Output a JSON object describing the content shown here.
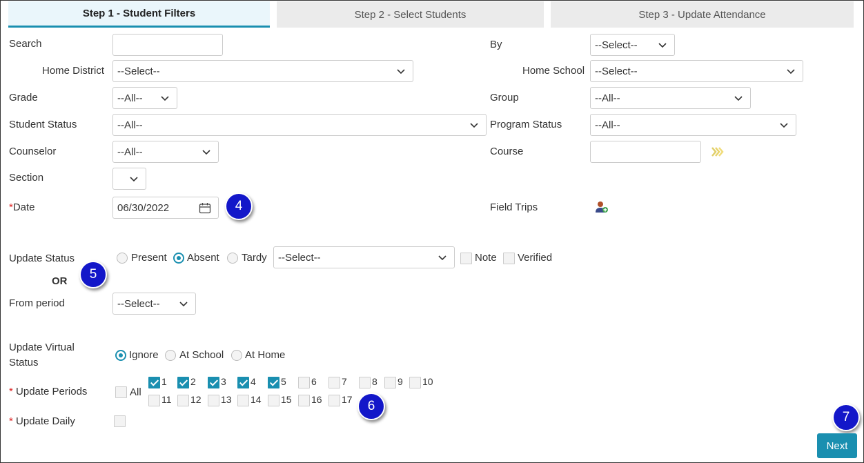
{
  "tabs": [
    {
      "label": "Step 1 - Student Filters"
    },
    {
      "label": "Step 2 - Select Students"
    },
    {
      "label": "Step 3 - Update Attendance"
    }
  ],
  "filters": {
    "search_label": "Search",
    "search_value": "",
    "by_label": "By",
    "by_value": "--Select--",
    "home_district_label": "Home District",
    "home_district_value": "--Select--",
    "home_school_label": "Home School",
    "home_school_value": "--Select--",
    "grade_label": "Grade",
    "grade_value": "--All--",
    "group_label": "Group",
    "group_value": "--All--",
    "student_status_label": "Student Status",
    "student_status_value": "--All--",
    "program_status_label": "Program Status",
    "program_status_value": "--All--",
    "counselor_label": "Counselor",
    "counselor_value": "--All--",
    "course_label": "Course",
    "course_value": "",
    "section_label": "Section",
    "section_value": "",
    "date_label": "Date",
    "date_required": "*",
    "date_value": "06/30/2022",
    "field_trips_label": "Field Trips"
  },
  "update_status": {
    "label": "Update Status",
    "present": "Present",
    "absent": "Absent",
    "tardy": "Tardy",
    "selected": "Absent",
    "reason_value": "--Select--",
    "note": "Note",
    "verified": "Verified",
    "or": "OR",
    "from_period_label": "From period",
    "from_period_value": "--Select--"
  },
  "virtual": {
    "label_line1": "Update Virtual",
    "label_line2": "Status",
    "ignore": "Ignore",
    "at_school": "At School",
    "at_home": "At Home",
    "selected": "Ignore"
  },
  "periods": {
    "required": "*",
    "label": "Update Periods",
    "all": "All",
    "items": [
      {
        "n": "1",
        "checked": true
      },
      {
        "n": "2",
        "checked": true
      },
      {
        "n": "3",
        "checked": true
      },
      {
        "n": "4",
        "checked": true
      },
      {
        "n": "5",
        "checked": true
      },
      {
        "n": "6",
        "checked": false
      },
      {
        "n": "7",
        "checked": false
      },
      {
        "n": "8",
        "checked": false
      },
      {
        "n": "9",
        "checked": false
      },
      {
        "n": "10",
        "checked": false
      },
      {
        "n": "11",
        "checked": false
      },
      {
        "n": "12",
        "checked": false
      },
      {
        "n": "13",
        "checked": false
      },
      {
        "n": "14",
        "checked": false
      },
      {
        "n": "15",
        "checked": false
      },
      {
        "n": "16",
        "checked": false
      },
      {
        "n": "17",
        "checked": false
      }
    ]
  },
  "daily": {
    "required": "*",
    "label": "Update Daily"
  },
  "callouts": [
    "4",
    "5",
    "6",
    "7"
  ],
  "next_label": "Next",
  "accent_color": "#1a8fb0",
  "callout_color": "#1317c9"
}
